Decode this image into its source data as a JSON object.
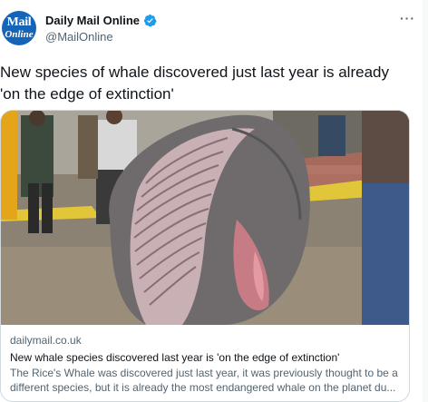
{
  "author": {
    "avatar_line1": "Mail",
    "avatar_line2": "Online",
    "display_name": "Daily Mail Online",
    "handle": "@MailOnline",
    "verified_icon": "verified-badge-icon",
    "more_icon": "more-options-icon",
    "more_label": "···"
  },
  "tweet": {
    "text": "New species of whale discovered just last year is already 'on the edge of extinction'"
  },
  "card": {
    "domain": "dailymail.co.uk",
    "title": "New whale species discovered last year is 'on the edge of extinction'",
    "description": "The Rice's Whale was discovered just last year, it was previously thought to be a different species, but it is already the most endangered whale on the planet du...",
    "image_alt": "Beached whale on its back surrounded by workers"
  },
  "colors": {
    "brand_blue": "#1564b8",
    "verified_blue": "#1d9bf0",
    "secondary_text": "#536471",
    "border": "#cfd9de"
  }
}
